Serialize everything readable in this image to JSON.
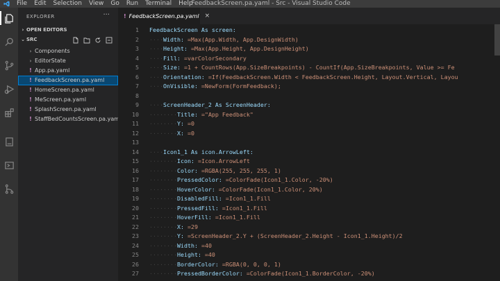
{
  "titlebar": {
    "menu": [
      "File",
      "Edit",
      "Selection",
      "View",
      "Go",
      "Run",
      "Terminal",
      "Help"
    ],
    "title": "FeedbackScreen.pa.yaml - Src - Visual Studio Code"
  },
  "activity_bar": {
    "icons": [
      "explorer-icon",
      "search-icon",
      "source-control-icon",
      "run-debug-icon",
      "extensions-icon",
      "power-apps-icon",
      "remote-icon",
      "git-graph-icon"
    ]
  },
  "sidebar": {
    "title": "EXPLORER",
    "more": "···",
    "open_editors": "OPEN EDITORS",
    "src": "SRC",
    "items": [
      {
        "type": "folder",
        "label": "Components"
      },
      {
        "type": "folder",
        "label": "EditorState"
      },
      {
        "type": "file",
        "label": "App.pa.yaml"
      },
      {
        "type": "file",
        "label": "FeedbackScreen.pa.yaml",
        "selected": true
      },
      {
        "type": "file",
        "label": "HomeScreen.pa.yaml"
      },
      {
        "type": "file",
        "label": "MeScreen.pa.yaml"
      },
      {
        "type": "file",
        "label": "SplashScreen.pa.yaml"
      },
      {
        "type": "file",
        "label": "StaffBedCountsScreen.pa.yaml"
      }
    ]
  },
  "editor": {
    "tab": {
      "label": "FeedbackScreen.pa.yaml",
      "close": "×"
    },
    "lines": [
      {
        "n": "1",
        "indent": 0,
        "key": "FeedbackScreen As screen:",
        "val": ""
      },
      {
        "n": "2",
        "indent": 1,
        "key": "Width:",
        "val": " =Max(App.Width, App.DesignWidth)"
      },
      {
        "n": "3",
        "indent": 1,
        "key": "Height:",
        "val": " =Max(App.Height, App.DesignHeight)"
      },
      {
        "n": "4",
        "indent": 1,
        "key": "Fill:",
        "val": " =varColorSecondary"
      },
      {
        "n": "5",
        "indent": 1,
        "key": "Size:",
        "val": " =1 + CountRows(App.SizeBreakpoints) - CountIf(App.SizeBreakpoints, Value >= Fe"
      },
      {
        "n": "6",
        "indent": 1,
        "key": "Orientation:",
        "val": " =If(FeedbackScreen.Width < FeedbackScreen.Height, Layout.Vertical, Layou"
      },
      {
        "n": "7",
        "indent": 1,
        "key": "OnVisible:",
        "val": " =NewForm(FormFeedback);"
      },
      {
        "n": "8",
        "indent": 0,
        "key": "",
        "val": ""
      },
      {
        "n": "9",
        "indent": 1,
        "key": "ScreenHeader_2 As ScreenHeader:",
        "val": ""
      },
      {
        "n": "10",
        "indent": 2,
        "key": "Title:",
        "val": " =\"App Feedback\""
      },
      {
        "n": "11",
        "indent": 2,
        "key": "Y:",
        "val": " =0"
      },
      {
        "n": "12",
        "indent": 2,
        "key": "X:",
        "val": " =0"
      },
      {
        "n": "13",
        "indent": 0,
        "key": "",
        "val": ""
      },
      {
        "n": "14",
        "indent": 1,
        "key": "Icon1_1 As icon.ArrowLeft:",
        "val": ""
      },
      {
        "n": "15",
        "indent": 2,
        "key": "Icon:",
        "val": " =Icon.ArrowLeft"
      },
      {
        "n": "16",
        "indent": 2,
        "key": "Color:",
        "val": " =RGBA(255, 255, 255, 1)"
      },
      {
        "n": "17",
        "indent": 2,
        "key": "PressedColor:",
        "val": " =ColorFade(Icon1_1.Color, -20%)"
      },
      {
        "n": "18",
        "indent": 2,
        "key": "HoverColor:",
        "val": " =ColorFade(Icon1_1.Color, 20%)"
      },
      {
        "n": "19",
        "indent": 2,
        "key": "DisabledFill:",
        "val": " =Icon1_1.Fill"
      },
      {
        "n": "20",
        "indent": 2,
        "key": "PressedFill:",
        "val": " =Icon1_1.Fill"
      },
      {
        "n": "21",
        "indent": 2,
        "key": "HoverFill:",
        "val": " =Icon1_1.Fill"
      },
      {
        "n": "22",
        "indent": 2,
        "key": "X:",
        "val": " =29"
      },
      {
        "n": "23",
        "indent": 2,
        "key": "Y:",
        "val": " =ScreenHeader_2.Y + (ScreenHeader_2.Height - Icon1_1.Height)/2"
      },
      {
        "n": "24",
        "indent": 2,
        "key": "Width:",
        "val": " =40"
      },
      {
        "n": "25",
        "indent": 2,
        "key": "Height:",
        "val": " =40"
      },
      {
        "n": "26",
        "indent": 2,
        "key": "BorderColor:",
        "val": " =RGBA(0, 0, 0, 1)"
      },
      {
        "n": "27",
        "indent": 2,
        "key": "PressedBorderColor:",
        "val": " =ColorFade(Icon1_1.BorderColor, -20%)"
      }
    ]
  },
  "colors": {
    "accent": "#007fd4",
    "selection": "#094771",
    "key": "#9cdcfe",
    "file_icon": "#c586c0"
  }
}
